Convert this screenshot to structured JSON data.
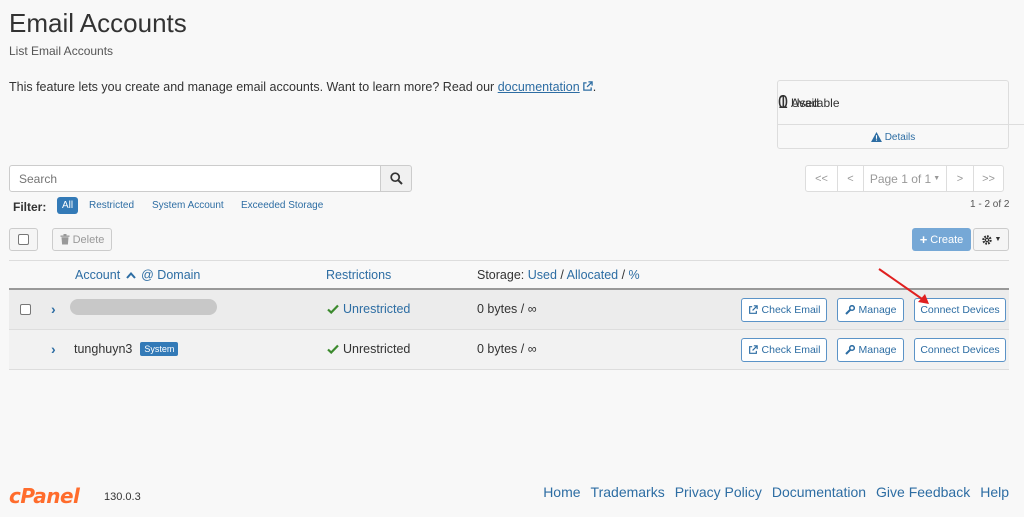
{
  "page": {
    "title": "Email Accounts",
    "subtitle": "List Email Accounts",
    "intro_text": "This feature lets you create and manage email accounts. Want to learn more? Read our",
    "intro_link": "documentation",
    "intro_end": "."
  },
  "stats": {
    "available_count": "0",
    "available_label": "Available",
    "used_count": "1",
    "used_label": "Used",
    "details_label": "Details"
  },
  "search": {
    "placeholder": "Search"
  },
  "pagination": {
    "first": "<<",
    "prev": "<",
    "page_label": "Page 1 of 1",
    "next": ">",
    "last": ">>"
  },
  "filter": {
    "label": "Filter:",
    "options": [
      "All",
      "Restricted",
      "System Account",
      "Exceeded Storage"
    ],
    "active": "All"
  },
  "result_count": "1 - 2 of 2",
  "toolbar": {
    "delete_label": "Delete",
    "create_label": "Create"
  },
  "table": {
    "headers": {
      "account": "Account",
      "at_domain": "@ Domain",
      "restrictions": "Restrictions",
      "storage_prefix": "Storage:",
      "used": "Used",
      "allocated": "Allocated",
      "percent": "%"
    },
    "rows": [
      {
        "account": "",
        "badge": "",
        "restriction": "Unrestricted",
        "storage": "0 bytes / ∞",
        "check_email": "Check Email",
        "manage": "Manage",
        "connect": "Connect Devices"
      },
      {
        "account": "tunghuyn3",
        "badge": "System",
        "restriction": "Unrestricted",
        "storage": "0 bytes / ∞",
        "check_email": "Check Email",
        "manage": "Manage",
        "connect": "Connect Devices"
      }
    ]
  },
  "footer": {
    "logo": "cPanel",
    "version": "130.0.3",
    "links": [
      "Home",
      "Trademarks",
      "Privacy Policy",
      "Documentation",
      "Give Feedback",
      "Help"
    ]
  },
  "colors": {
    "accent": "#2d6da3",
    "primary_button": "#337ab7",
    "logo": "#ff6c2c",
    "check_green": "#3c8a2e",
    "annotation_arrow": "#e02020"
  }
}
